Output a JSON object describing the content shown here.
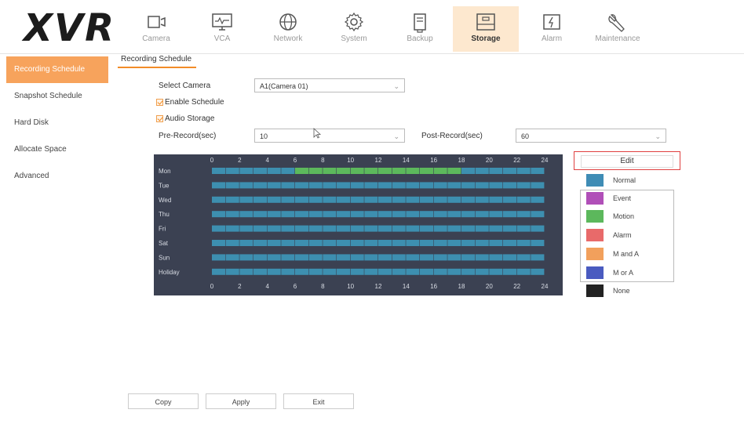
{
  "app": {
    "logo": "XVR"
  },
  "nav": [
    {
      "label": "Camera",
      "icon": "camera-icon"
    },
    {
      "label": "VCA",
      "icon": "vca-monitor-icon"
    },
    {
      "label": "Network",
      "icon": "globe-icon"
    },
    {
      "label": "System",
      "icon": "gear-icon"
    },
    {
      "label": "Backup",
      "icon": "backup-icon"
    },
    {
      "label": "Storage",
      "icon": "storage-icon",
      "active": true
    },
    {
      "label": "Alarm",
      "icon": "alarm-icon"
    },
    {
      "label": "Maintenance",
      "icon": "wrench-icon"
    }
  ],
  "sidebar": {
    "items": [
      {
        "label": "Recording Schedule",
        "active": true
      },
      {
        "label": "Snapshot Schedule"
      },
      {
        "label": "Hard Disk"
      },
      {
        "label": "Allocate Space"
      },
      {
        "label": "Advanced"
      }
    ]
  },
  "main": {
    "tab": "Recording Schedule",
    "select_camera_label": "Select Camera",
    "select_camera_value": "A1(Camera 01)",
    "enable_schedule_label": "Enable Schedule",
    "audio_storage_label": "Audio Storage",
    "pre_record_label": "Pre-Record(sec)",
    "pre_record_value": "10",
    "post_record_label": "Post-Record(sec)",
    "post_record_value": "60"
  },
  "schedule": {
    "hour_labels": [
      "0",
      "2",
      "4",
      "6",
      "8",
      "10",
      "12",
      "14",
      "16",
      "18",
      "20",
      "22",
      "24"
    ],
    "days": [
      "Mon",
      "Tue",
      "Wed",
      "Thu",
      "Fri",
      "Sat",
      "Sun",
      "Holiday"
    ],
    "motion_range_mon": [
      6,
      18
    ],
    "normal_color": "#3d8fb0",
    "motion_color": "#5cb85c",
    "grid_bg": "#3b4152"
  },
  "legend": {
    "edit_label": "Edit",
    "items": [
      {
        "label": "Normal",
        "color": "#3f8cb5"
      },
      {
        "label": "Event",
        "color": "#b04fb8"
      },
      {
        "label": "Motion",
        "color": "#5cb85c"
      },
      {
        "label": "Alarm",
        "color": "#e86a6a"
      },
      {
        "label": "M and A",
        "color": "#f2a05c"
      },
      {
        "label": "M or A",
        "color": "#4a5bc0"
      },
      {
        "label": "None",
        "color": "#222222"
      }
    ]
  },
  "buttons": {
    "copy": "Copy",
    "apply": "Apply",
    "exit": "Exit"
  }
}
